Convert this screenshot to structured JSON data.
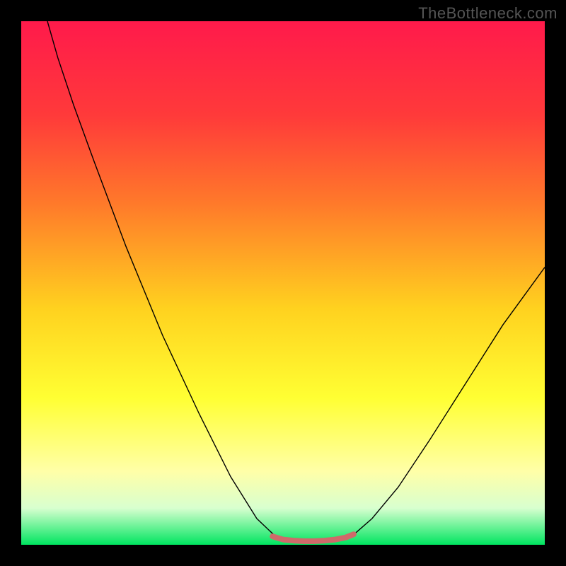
{
  "watermark": "TheBottleneck.com",
  "chart_data": {
    "type": "line",
    "title": "",
    "xlabel": "",
    "ylabel": "",
    "xlim": [
      0,
      100
    ],
    "ylim": [
      0,
      100
    ],
    "background_gradient": {
      "stops": [
        {
          "offset": 0.0,
          "color": "#ff1a4b"
        },
        {
          "offset": 0.18,
          "color": "#ff3a3a"
        },
        {
          "offset": 0.35,
          "color": "#ff7a2a"
        },
        {
          "offset": 0.55,
          "color": "#ffd21f"
        },
        {
          "offset": 0.72,
          "color": "#ffff33"
        },
        {
          "offset": 0.86,
          "color": "#ffffa8"
        },
        {
          "offset": 0.93,
          "color": "#d8ffcf"
        },
        {
          "offset": 1.0,
          "color": "#00e560"
        }
      ]
    },
    "series": [
      {
        "name": "bottleneck-curve",
        "color": "#000000",
        "width": 1.4,
        "points": [
          {
            "x": 5.0,
            "y": 100.0
          },
          {
            "x": 7.0,
            "y": 93.0
          },
          {
            "x": 10.0,
            "y": 84.0
          },
          {
            "x": 14.0,
            "y": 73.0
          },
          {
            "x": 20.0,
            "y": 57.0
          },
          {
            "x": 27.0,
            "y": 40.0
          },
          {
            "x": 34.0,
            "y": 25.0
          },
          {
            "x": 40.0,
            "y": 13.0
          },
          {
            "x": 45.0,
            "y": 5.0
          },
          {
            "x": 49.0,
            "y": 1.2
          },
          {
            "x": 52.0,
            "y": 0.6
          },
          {
            "x": 56.0,
            "y": 0.5
          },
          {
            "x": 60.0,
            "y": 0.7
          },
          {
            "x": 63.0,
            "y": 1.5
          },
          {
            "x": 67.0,
            "y": 5.0
          },
          {
            "x": 72.0,
            "y": 11.0
          },
          {
            "x": 78.0,
            "y": 20.0
          },
          {
            "x": 85.0,
            "y": 31.0
          },
          {
            "x": 92.0,
            "y": 42.0
          },
          {
            "x": 100.0,
            "y": 53.0
          }
        ]
      },
      {
        "name": "optimal-band",
        "color": "#cf6a6a",
        "width": 8,
        "points": [
          {
            "x": 48.0,
            "y": 1.6
          },
          {
            "x": 50.0,
            "y": 1.0
          },
          {
            "x": 52.0,
            "y": 0.8
          },
          {
            "x": 54.0,
            "y": 0.7
          },
          {
            "x": 56.0,
            "y": 0.7
          },
          {
            "x": 58.0,
            "y": 0.8
          },
          {
            "x": 60.0,
            "y": 1.0
          },
          {
            "x": 62.0,
            "y": 1.4
          },
          {
            "x": 63.5,
            "y": 2.0
          }
        ]
      }
    ]
  }
}
